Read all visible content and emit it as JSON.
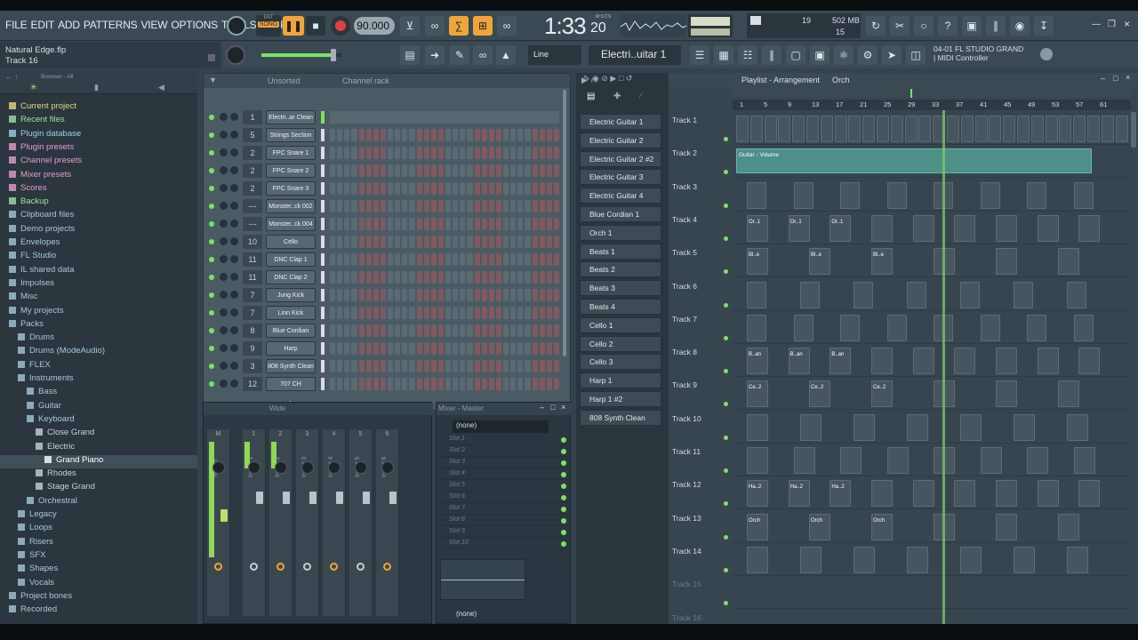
{
  "menu": [
    "FILE",
    "EDIT",
    "ADD",
    "PATTERNS",
    "VIEW",
    "OPTIONS",
    "TOOLS",
    "HELP"
  ],
  "transport": {
    "pat_label": "PAT",
    "song_label": "SONG",
    "tempo": "90.000",
    "time": "1:33",
    "time_sub": "20",
    "time_unit": "M:S:CS",
    "cpu": "19",
    "ram": "502 MB",
    "poly": "15"
  },
  "project": {
    "filename": "Natural Edge.flp",
    "hint": "Track 16"
  },
  "row2": {
    "snap": "Line",
    "channel_select": "Electri..uitar 1",
    "midi_info_top": "04-01  FL STUDIO GRAND",
    "midi_info_bottom": "| MIDI Controller"
  },
  "browser": {
    "header": "Browser - All",
    "items": [
      {
        "label": "Current project",
        "level": 0,
        "color": "#e8d88a"
      },
      {
        "label": "Recent files",
        "level": 0,
        "color": "#9ee0a8"
      },
      {
        "label": "Plugin database",
        "level": 0,
        "color": "#9ed0e8"
      },
      {
        "label": "Plugin presets",
        "level": 0,
        "color": "#e0a0c8"
      },
      {
        "label": "Channel presets",
        "level": 0,
        "color": "#e0a0c8"
      },
      {
        "label": "Mixer presets",
        "level": 0,
        "color": "#e0a0c8"
      },
      {
        "label": "Scores",
        "level": 0,
        "color": "#e0a0c8"
      },
      {
        "label": "Backup",
        "level": 0,
        "color": "#9ee0a8"
      },
      {
        "label": "Clipboard files",
        "level": 0,
        "color": "#a8c8d8"
      },
      {
        "label": "Demo projects",
        "level": 0,
        "color": "#a8c8d8"
      },
      {
        "label": "Envelopes",
        "level": 0,
        "color": "#a8c8d8"
      },
      {
        "label": "FL Studio",
        "level": 0,
        "color": "#a8c8d8"
      },
      {
        "label": "IL shared data",
        "level": 0,
        "color": "#a8c8d8"
      },
      {
        "label": "Impulses",
        "level": 0,
        "color": "#a8c8d8"
      },
      {
        "label": "Misc",
        "level": 0,
        "color": "#a8c8d8"
      },
      {
        "label": "My projects",
        "level": 0,
        "color": "#a8c8d8"
      },
      {
        "label": "Packs",
        "level": 0,
        "color": "#a8c8d8"
      },
      {
        "label": "Drums",
        "level": 1,
        "color": "#a8c8d8"
      },
      {
        "label": "Drums (ModeAudio)",
        "level": 1,
        "color": "#a8c8d8"
      },
      {
        "label": "FLEX",
        "level": 1,
        "color": "#a8c8d8"
      },
      {
        "label": "Instruments",
        "level": 1,
        "color": "#a8c8d8"
      },
      {
        "label": "Bass",
        "level": 2,
        "color": "#a8c8d8"
      },
      {
        "label": "Guitar",
        "level": 2,
        "color": "#a8c8d8"
      },
      {
        "label": "Keyboard",
        "level": 2,
        "color": "#a8c8d8"
      },
      {
        "label": "Close Grand",
        "level": 3,
        "color": "#c8d4d8"
      },
      {
        "label": "Electric",
        "level": 3,
        "color": "#c8d4d8"
      },
      {
        "label": "Grand Piano",
        "level": 4,
        "color": "#ffffff"
      },
      {
        "label": "Rhodes",
        "level": 3,
        "color": "#c8d4d8"
      },
      {
        "label": "Stage Grand",
        "level": 3,
        "color": "#c8d4d8"
      },
      {
        "label": "Orchestral",
        "level": 2,
        "color": "#a8c8d8"
      },
      {
        "label": "Legacy",
        "level": 1,
        "color": "#a8c8d8"
      },
      {
        "label": "Loops",
        "level": 1,
        "color": "#a8c8d8"
      },
      {
        "label": "Risers",
        "level": 1,
        "color": "#a8c8d8"
      },
      {
        "label": "SFX",
        "level": 1,
        "color": "#a8c8d8"
      },
      {
        "label": "Shapes",
        "level": 1,
        "color": "#a8c8d8"
      },
      {
        "label": "Vocals",
        "level": 1,
        "color": "#a8c8d8"
      },
      {
        "label": "Project bones",
        "level": 0,
        "color": "#a8c8d8"
      },
      {
        "label": "Recorded",
        "level": 0,
        "color": "#a8c8d8"
      }
    ]
  },
  "channel_rack": {
    "filter": "Unsorted",
    "title": "Channel rack",
    "channels": [
      {
        "num": "1",
        "name": "Electri..ar Clean"
      },
      {
        "num": "5",
        "name": "Strings Section"
      },
      {
        "num": "2",
        "name": "FPC Snare 1"
      },
      {
        "num": "2",
        "name": "FPC Snare 2"
      },
      {
        "num": "2",
        "name": "FPC Snare 3"
      },
      {
        "num": "---",
        "name": "Monster..ck 002"
      },
      {
        "num": "---",
        "name": "Monster..ck 004"
      },
      {
        "num": "10",
        "name": "Cello"
      },
      {
        "num": "11",
        "name": "DNC Clap 1"
      },
      {
        "num": "11",
        "name": "DNC Clap 2"
      },
      {
        "num": "7",
        "name": "Jung Kick"
      },
      {
        "num": "7",
        "name": "Linn Kick"
      },
      {
        "num": "8",
        "name": "Blue Cordian"
      },
      {
        "num": "9",
        "name": "Harp"
      },
      {
        "num": "3",
        "name": "808 Synth Clean"
      },
      {
        "num": "12",
        "name": "707 CH"
      }
    ],
    "add_label": "+"
  },
  "mixer": {
    "mode": "Wide",
    "strip_labels": [
      "M",
      "1",
      "2",
      "3",
      "4",
      "5",
      "6"
    ],
    "insert_names": [
      "Master",
      "Insert 1",
      "Insert 2",
      "Insert 3",
      "Insert 4",
      "Insert 5",
      "Insert 6"
    ]
  },
  "mixer_panel": {
    "title": "Mixer - Master",
    "input": "(none)",
    "output": "(none)",
    "slots": [
      "Slot 1",
      "Slot 2",
      "Slot 3",
      "Slot 4",
      "Slot 5",
      "Slot 6",
      "Slot 7",
      "Slot 8",
      "Slot 9",
      "Slot 10"
    ]
  },
  "pattern_picker": [
    "Electric Guitar 1",
    "Electric Guitar 2",
    "Electric Guitar 2 #2",
    "Electric Guitar 3",
    "Electric Guitar 4",
    "Blue Cordian 1",
    "Orch 1",
    "Beats 1",
    "Beats 2",
    "Beats 3",
    "Beats 4",
    "Cello 1",
    "Cello 2",
    "Cello 3",
    "Harp 1",
    "Harp 1 #2",
    "808 Synth Clean"
  ],
  "playlist": {
    "title": "Playlist - Arrangement",
    "crumb": "Orch",
    "ruler": [
      "1",
      "5",
      "9",
      "13",
      "17",
      "21",
      "25",
      "29",
      "33",
      "37",
      "41",
      "45",
      "49",
      "53",
      "57",
      "61"
    ],
    "tracks": [
      "Track 1",
      "Track 2",
      "Track 3",
      "Track 4",
      "Track 5",
      "Track 6",
      "Track 7",
      "Track 8",
      "Track 9",
      "Track 10",
      "Track 11",
      "Track 12",
      "Track 13",
      "Track 14",
      "Track 15",
      "Track 16"
    ],
    "clip_labels": {
      "t2": "Guitar - Volume",
      "t4": "Or..1",
      "t5": "Bl..e",
      "t8": "B..an",
      "t9": "Ce..2",
      "t12": "Ha..2",
      "t13": "Orch"
    }
  },
  "colors": {
    "accent_green": "#7ee06a",
    "song_orange": "#f0a53a",
    "record_red": "#e0404a",
    "clip_teal": "#4e8f86",
    "playhead": "#8ee06a"
  }
}
